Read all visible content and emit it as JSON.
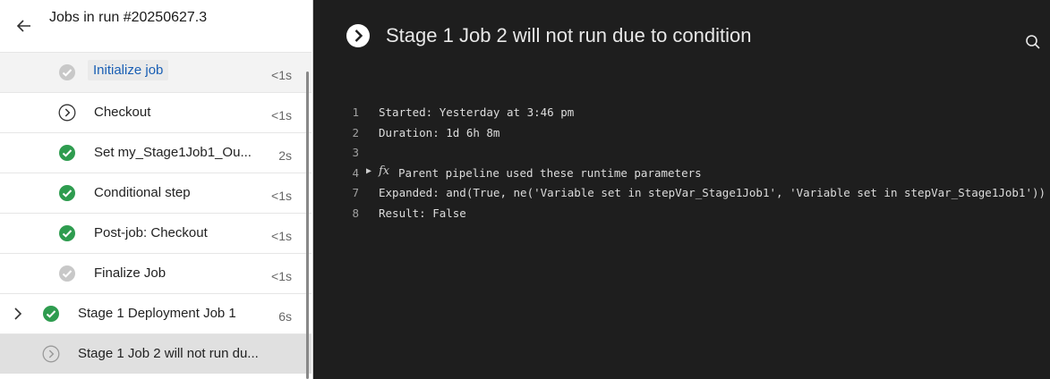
{
  "left": {
    "title": "Jobs in run #20250627.3",
    "steps": [
      {
        "label": "Initialize job",
        "duration": "<1s",
        "status": "skipped"
      },
      {
        "label": "Checkout",
        "duration": "<1s",
        "status": "not-run"
      },
      {
        "label": "Set my_Stage1Job1_Ou...",
        "duration": "2s",
        "status": "success"
      },
      {
        "label": "Conditional step",
        "duration": "<1s",
        "status": "success"
      },
      {
        "label": "Post-job: Checkout",
        "duration": "<1s",
        "status": "success"
      },
      {
        "label": "Finalize Job",
        "duration": "<1s",
        "status": "skipped"
      },
      {
        "label": "Stage 1 Deployment Job 1",
        "duration": "6s",
        "status": "success"
      },
      {
        "label": "Stage 1 Job 2 will not run du...",
        "duration": "",
        "status": "not-run"
      }
    ]
  },
  "right": {
    "title": "Stage 1 Job 2 will not run due to condition",
    "log": [
      {
        "num": "1",
        "text": "Started: Yesterday at 3:46 pm"
      },
      {
        "num": "2",
        "text": "Duration: 1d 6h 8m"
      },
      {
        "num": "3",
        "text": ""
      },
      {
        "num": "4",
        "text": "Parent pipeline used these runtime parameters"
      },
      {
        "num": "7",
        "text": "Expanded: and(True, ne('Variable set in stepVar_Stage1Job1', 'Variable set in stepVar_Stage1Job1'))"
      },
      {
        "num": "8",
        "text": "Result: False"
      }
    ]
  },
  "colors": {
    "success": "#2e9c4f",
    "skipped": "#c8c8c8",
    "accent": "#1a5fb4"
  },
  "icons": {
    "back": "arrow-left-icon",
    "search": "search-icon",
    "expand": "chevron-right-icon",
    "function": "fx-icon"
  }
}
